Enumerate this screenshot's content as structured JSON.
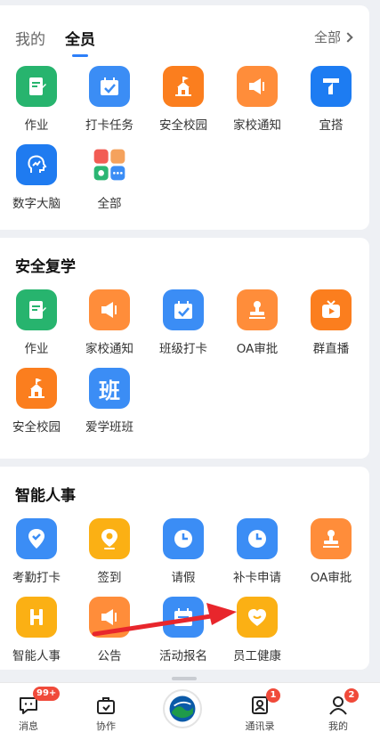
{
  "tabs": [
    {
      "label": "我的"
    },
    {
      "label": "全员"
    }
  ],
  "all_link": "全部",
  "section1": {
    "items": [
      {
        "label": "作业",
        "icon": "homework-icon",
        "color": "green"
      },
      {
        "label": "打卡任务",
        "icon": "calendar-check-icon",
        "color": "blue"
      },
      {
        "label": "安全校园",
        "icon": "school-building-icon",
        "color": "orange"
      },
      {
        "label": "家校通知",
        "icon": "megaphone-icon",
        "color": "lorange"
      },
      {
        "label": "宜搭",
        "icon": "yida-icon",
        "color": "blue"
      },
      {
        "label": "数字大脑",
        "icon": "brain-icon",
        "color": "blue"
      },
      {
        "label": "全部",
        "icon": "all-apps-icon",
        "color": "none"
      }
    ]
  },
  "section2": {
    "title": "安全复学",
    "items": [
      {
        "label": "作业",
        "icon": "homework-icon",
        "color": "green"
      },
      {
        "label": "家校通知",
        "icon": "megaphone-icon",
        "color": "lorange"
      },
      {
        "label": "班级打卡",
        "icon": "calendar-check-icon",
        "color": "blue"
      },
      {
        "label": "OA审批",
        "icon": "stamp-icon",
        "color": "lorange"
      },
      {
        "label": "群直播",
        "icon": "live-tv-icon",
        "color": "orange"
      },
      {
        "label": "安全校园",
        "icon": "school-building-icon",
        "color": "orange"
      },
      {
        "label": "爱学班班",
        "icon": "ban-text-icon",
        "color": "blue",
        "glyph": "班"
      }
    ]
  },
  "section3": {
    "title": "智能人事",
    "items": [
      {
        "label": "考勤打卡",
        "icon": "location-check-icon",
        "color": "blue"
      },
      {
        "label": "签到",
        "icon": "location-pin-icon",
        "color": "yellow"
      },
      {
        "label": "请假",
        "icon": "clock-icon",
        "color": "blue"
      },
      {
        "label": "补卡申请",
        "icon": "clock-icon",
        "color": "blue"
      },
      {
        "label": "OA审批",
        "icon": "stamp-icon",
        "color": "lorange"
      },
      {
        "label": "智能人事",
        "icon": "h-letter-icon",
        "color": "yellow"
      },
      {
        "label": "公告",
        "icon": "megaphone-icon",
        "color": "lorange"
      },
      {
        "label": "活动报名",
        "icon": "calendar-icon",
        "color": "blue"
      },
      {
        "label": "员工健康",
        "icon": "heart-smile-icon",
        "color": "yellow"
      }
    ]
  },
  "nav": {
    "messages": {
      "label": "消息",
      "badge": "99+"
    },
    "collab": {
      "label": "协作"
    },
    "contacts": {
      "label": "通讯录",
      "badge": "1"
    },
    "mine": {
      "label": "我的",
      "badge": "2"
    }
  },
  "colors": {
    "green": "#27b46e",
    "blue": "#3b8df5",
    "orange": "#fb7e1e",
    "lorange": "#ff8d3a",
    "yellow": "#fbb014",
    "accent": "#2d7ff9",
    "badge": "#f04a3a",
    "arrow": "#e8262c"
  }
}
